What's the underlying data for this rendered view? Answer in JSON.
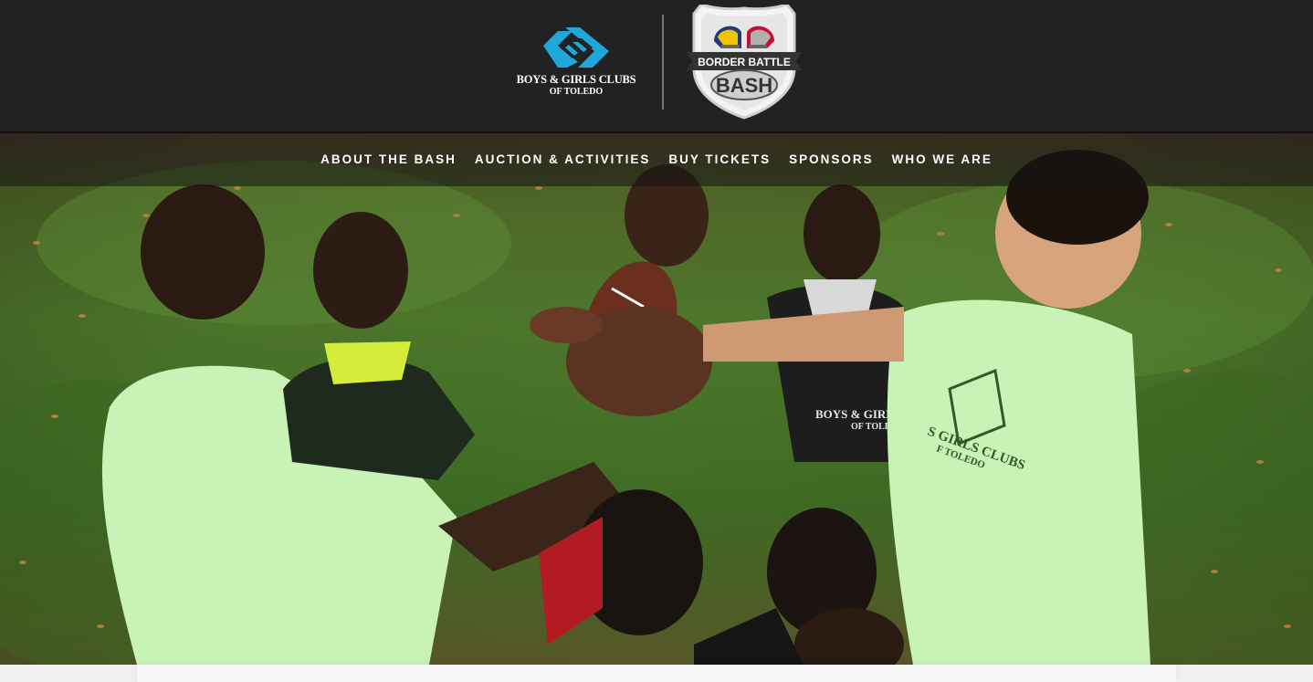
{
  "header": {
    "bgc_logo": {
      "line1": "BOYS & GIRLS CLUBS",
      "line2": "OF TOLEDO",
      "icon": "bgc-hands-icon",
      "color": "#1ea7d8"
    },
    "bash_logo": {
      "line1": "BORDER BATTLE",
      "line2": "BASH",
      "icon": "football-helmets-shield-icon"
    }
  },
  "nav": {
    "items": [
      {
        "label": "ABOUT THE BASH"
      },
      {
        "label": "AUCTION & ACTIVITIES"
      },
      {
        "label": "BUY TICKETS"
      },
      {
        "label": "SPONSORS"
      },
      {
        "label": "WHO WE ARE"
      }
    ]
  },
  "hero": {
    "shirt_text_left": "BOYS & GIRLS CLUBS",
    "shirt_text_left_2": "OF TOLEDO",
    "shirt_text_right": "S GIRLS CLUBS",
    "shirt_text_right_2": "F TOLEDO"
  },
  "colors": {
    "header_bg": "#222222",
    "nav_text": "#ffffff",
    "brand_blue": "#1ea7d8",
    "shirt_green": "#c9f2b7"
  }
}
